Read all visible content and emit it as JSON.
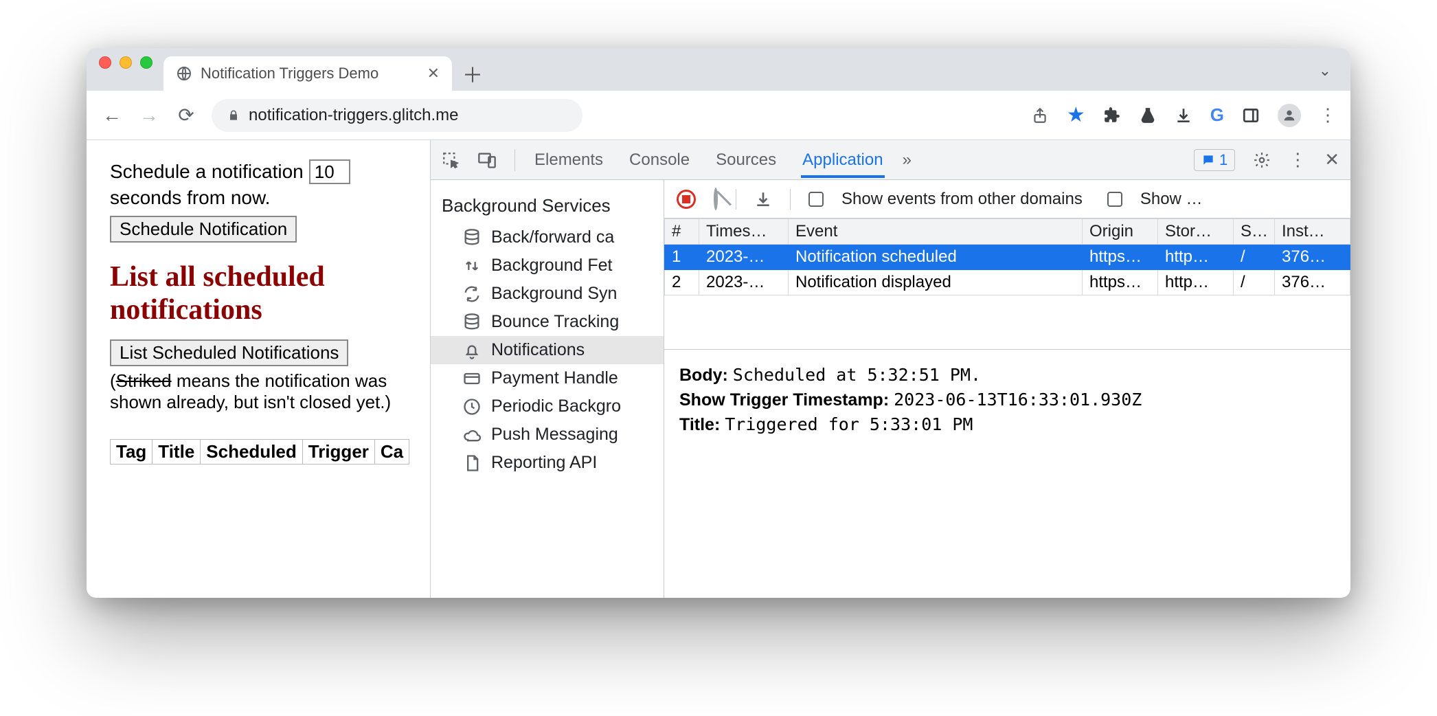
{
  "browser": {
    "tab_title": "Notification Triggers Demo",
    "url_display": "notification-triggers.glitch.me"
  },
  "page": {
    "schedule_prefix": "Schedule a notification",
    "schedule_seconds": "10",
    "schedule_suffix": "seconds from now.",
    "schedule_button": "Schedule Notification",
    "heading": "List all scheduled notifications",
    "list_button": "List Scheduled Notifications",
    "note_open": "(",
    "note_striked": "Striked",
    "note_rest": " means the notification was shown already, but isn't closed yet.)",
    "table_cols": [
      "Tag",
      "Title",
      "Scheduled",
      "Trigger",
      "Ca"
    ]
  },
  "devtools": {
    "tabs": [
      "Elements",
      "Console",
      "Sources",
      "Application"
    ],
    "active_tab": "Application",
    "issue_count": "1",
    "sidebar_heading": "Background Services",
    "sidebar_items": [
      "Back/forward ca",
      "Background Fet",
      "Background Syn",
      "Bounce Tracking",
      "Notifications",
      "Payment Handle",
      "Periodic Backgro",
      "Push Messaging",
      "Reporting API"
    ],
    "sidebar_selected_index": 4,
    "toolbar2": {
      "show_other": "Show events from other domains",
      "show_trunc": "Show …"
    },
    "events": {
      "columns": [
        "#",
        "Times…",
        "Event",
        "Origin",
        "Stor…",
        "S…",
        "Inst…"
      ],
      "rows": [
        {
          "n": "1",
          "ts": "2023-…",
          "event": "Notification scheduled",
          "origin": "https…",
          "storage": "http…",
          "scope": "/",
          "inst": "376…",
          "selected": true
        },
        {
          "n": "2",
          "ts": "2023-…",
          "event": "Notification displayed",
          "origin": "https…",
          "storage": "http…",
          "scope": "/",
          "inst": "376…",
          "selected": false
        }
      ]
    },
    "details": {
      "body_label": "Body:",
      "body_value": "Scheduled at 5:32:51 PM.",
      "ts_label": "Show Trigger Timestamp:",
      "ts_value": "2023-06-13T16:33:01.930Z",
      "title_label": "Title:",
      "title_value": "Triggered for 5:33:01 PM"
    }
  }
}
